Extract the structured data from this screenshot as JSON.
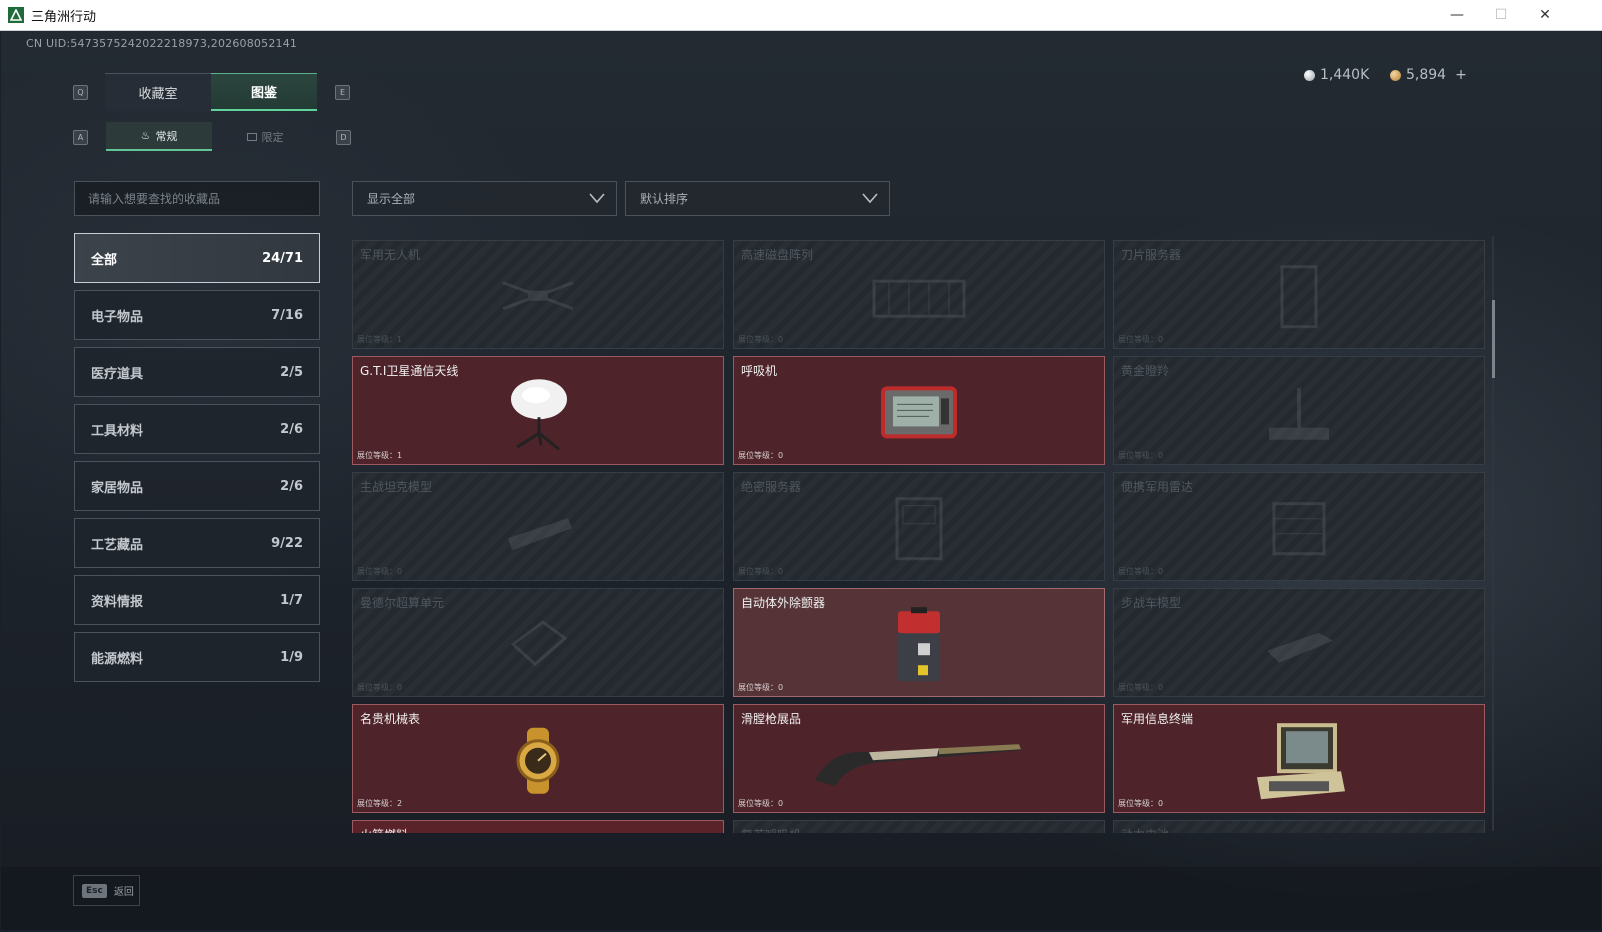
{
  "window": {
    "title": "三角洲行动",
    "minimize": "—",
    "maximize": "☐",
    "close": "✕"
  },
  "header": {
    "uid": "CN UID:5473575242022218973,202608052141",
    "currency": [
      {
        "value": "1,440K",
        "color": "#c9cdd2"
      },
      {
        "value": "5,894",
        "color": "#d8a65a",
        "plus": "+"
      }
    ]
  },
  "keys": {
    "prev_tab": "Q",
    "next_tab": "E",
    "prev_sub": "A",
    "next_sub": "D"
  },
  "tabs": [
    {
      "label": "收藏室",
      "active": false
    },
    {
      "label": "图鉴",
      "active": true
    }
  ],
  "subtabs": [
    {
      "label": "常规",
      "icon": "flame-icon",
      "active": true
    },
    {
      "label": "限定",
      "icon": "image-icon",
      "active": false
    }
  ],
  "search": {
    "placeholder": "请输入想要查找的收藏品"
  },
  "filters": {
    "show": "显示全部",
    "sort": "默认排序"
  },
  "categories": [
    {
      "label": "全部",
      "count": "24/71",
      "active": true
    },
    {
      "label": "电子物品",
      "count": "7/16"
    },
    {
      "label": "医疗道具",
      "count": "2/5"
    },
    {
      "label": "工具材料",
      "count": "2/6"
    },
    {
      "label": "家居物品",
      "count": "2/6"
    },
    {
      "label": "工艺藏品",
      "count": "9/22"
    },
    {
      "label": "资料情报",
      "count": "1/7"
    },
    {
      "label": "能源燃料",
      "count": "1/9"
    }
  ],
  "items": [
    {
      "name": "军用无人机",
      "level": "展位等级：1",
      "owned": false,
      "icon": "drone-icon"
    },
    {
      "name": "高速磁盘阵列",
      "level": "展位等级：0",
      "owned": false,
      "icon": "disk-array-icon"
    },
    {
      "name": "刀片服务器",
      "level": "展位等级：0",
      "owned": false,
      "icon": "blade-server-icon"
    },
    {
      "name": "G.T.I卫星通信天线",
      "level": "展位等级：1",
      "owned": true,
      "icon": "satellite-dish-icon"
    },
    {
      "name": "呼吸机",
      "level": "展位等级：0",
      "owned": true,
      "icon": "ventilator-icon"
    },
    {
      "name": "黄金瞪羚",
      "level": "展位等级：0",
      "owned": false,
      "icon": "gazelle-icon"
    },
    {
      "name": "主战坦克模型",
      "level": "展位等级：0",
      "owned": false,
      "icon": "tank-model-icon"
    },
    {
      "name": "绝密服务器",
      "level": "展位等级：0",
      "owned": false,
      "icon": "server-icon"
    },
    {
      "name": "便携军用雷达",
      "level": "展位等级：0",
      "owned": false,
      "icon": "radar-icon"
    },
    {
      "name": "曼德尔超算单元",
      "level": "展位等级：0",
      "owned": false,
      "icon": "compute-unit-icon"
    },
    {
      "name": "自动体外除颤器",
      "level": "展位等级：0",
      "owned": true,
      "light": true,
      "icon": "defibrillator-icon"
    },
    {
      "name": "步战车模型",
      "level": "展位等级：0",
      "owned": false,
      "icon": "ifv-model-icon"
    },
    {
      "name": "名贵机械表",
      "level": "展位等级：2",
      "owned": true,
      "icon": "watch-icon"
    },
    {
      "name": "滑膛枪展品",
      "level": "展位等级：0",
      "owned": true,
      "icon": "musket-icon"
    },
    {
      "name": "军用信息终端",
      "level": "展位等级：0",
      "owned": true,
      "icon": "terminal-icon"
    },
    {
      "name": "火箭燃料",
      "level": "",
      "owned": true,
      "icon": "fuel-icon"
    },
    {
      "name": "复苏呼吸机",
      "level": "",
      "owned": false,
      "icon": "respirator-icon"
    },
    {
      "name": "动力电池",
      "level": "",
      "owned": false,
      "icon": "battery-icon"
    }
  ],
  "footer": {
    "key": "Esc",
    "label": "返回"
  }
}
